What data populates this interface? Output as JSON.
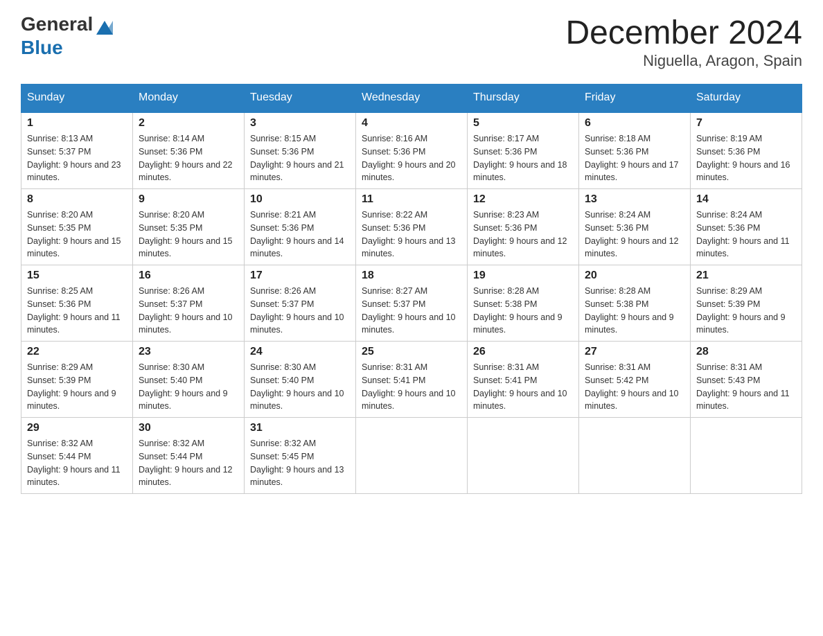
{
  "header": {
    "logo_general": "General",
    "logo_blue": "Blue",
    "title": "December 2024",
    "subtitle": "Niguella, Aragon, Spain"
  },
  "weekdays": [
    "Sunday",
    "Monday",
    "Tuesday",
    "Wednesday",
    "Thursday",
    "Friday",
    "Saturday"
  ],
  "weeks": [
    [
      {
        "day": "1",
        "sunrise": "8:13 AM",
        "sunset": "5:37 PM",
        "daylight": "9 hours and 23 minutes."
      },
      {
        "day": "2",
        "sunrise": "8:14 AM",
        "sunset": "5:36 PM",
        "daylight": "9 hours and 22 minutes."
      },
      {
        "day": "3",
        "sunrise": "8:15 AM",
        "sunset": "5:36 PM",
        "daylight": "9 hours and 21 minutes."
      },
      {
        "day": "4",
        "sunrise": "8:16 AM",
        "sunset": "5:36 PM",
        "daylight": "9 hours and 20 minutes."
      },
      {
        "day": "5",
        "sunrise": "8:17 AM",
        "sunset": "5:36 PM",
        "daylight": "9 hours and 18 minutes."
      },
      {
        "day": "6",
        "sunrise": "8:18 AM",
        "sunset": "5:36 PM",
        "daylight": "9 hours and 17 minutes."
      },
      {
        "day": "7",
        "sunrise": "8:19 AM",
        "sunset": "5:36 PM",
        "daylight": "9 hours and 16 minutes."
      }
    ],
    [
      {
        "day": "8",
        "sunrise": "8:20 AM",
        "sunset": "5:35 PM",
        "daylight": "9 hours and 15 minutes."
      },
      {
        "day": "9",
        "sunrise": "8:20 AM",
        "sunset": "5:35 PM",
        "daylight": "9 hours and 15 minutes."
      },
      {
        "day": "10",
        "sunrise": "8:21 AM",
        "sunset": "5:36 PM",
        "daylight": "9 hours and 14 minutes."
      },
      {
        "day": "11",
        "sunrise": "8:22 AM",
        "sunset": "5:36 PM",
        "daylight": "9 hours and 13 minutes."
      },
      {
        "day": "12",
        "sunrise": "8:23 AM",
        "sunset": "5:36 PM",
        "daylight": "9 hours and 12 minutes."
      },
      {
        "day": "13",
        "sunrise": "8:24 AM",
        "sunset": "5:36 PM",
        "daylight": "9 hours and 12 minutes."
      },
      {
        "day": "14",
        "sunrise": "8:24 AM",
        "sunset": "5:36 PM",
        "daylight": "9 hours and 11 minutes."
      }
    ],
    [
      {
        "day": "15",
        "sunrise": "8:25 AM",
        "sunset": "5:36 PM",
        "daylight": "9 hours and 11 minutes."
      },
      {
        "day": "16",
        "sunrise": "8:26 AM",
        "sunset": "5:37 PM",
        "daylight": "9 hours and 10 minutes."
      },
      {
        "day": "17",
        "sunrise": "8:26 AM",
        "sunset": "5:37 PM",
        "daylight": "9 hours and 10 minutes."
      },
      {
        "day": "18",
        "sunrise": "8:27 AM",
        "sunset": "5:37 PM",
        "daylight": "9 hours and 10 minutes."
      },
      {
        "day": "19",
        "sunrise": "8:28 AM",
        "sunset": "5:38 PM",
        "daylight": "9 hours and 9 minutes."
      },
      {
        "day": "20",
        "sunrise": "8:28 AM",
        "sunset": "5:38 PM",
        "daylight": "9 hours and 9 minutes."
      },
      {
        "day": "21",
        "sunrise": "8:29 AM",
        "sunset": "5:39 PM",
        "daylight": "9 hours and 9 minutes."
      }
    ],
    [
      {
        "day": "22",
        "sunrise": "8:29 AM",
        "sunset": "5:39 PM",
        "daylight": "9 hours and 9 minutes."
      },
      {
        "day": "23",
        "sunrise": "8:30 AM",
        "sunset": "5:40 PM",
        "daylight": "9 hours and 9 minutes."
      },
      {
        "day": "24",
        "sunrise": "8:30 AM",
        "sunset": "5:40 PM",
        "daylight": "9 hours and 10 minutes."
      },
      {
        "day": "25",
        "sunrise": "8:31 AM",
        "sunset": "5:41 PM",
        "daylight": "9 hours and 10 minutes."
      },
      {
        "day": "26",
        "sunrise": "8:31 AM",
        "sunset": "5:41 PM",
        "daylight": "9 hours and 10 minutes."
      },
      {
        "day": "27",
        "sunrise": "8:31 AM",
        "sunset": "5:42 PM",
        "daylight": "9 hours and 10 minutes."
      },
      {
        "day": "28",
        "sunrise": "8:31 AM",
        "sunset": "5:43 PM",
        "daylight": "9 hours and 11 minutes."
      }
    ],
    [
      {
        "day": "29",
        "sunrise": "8:32 AM",
        "sunset": "5:44 PM",
        "daylight": "9 hours and 11 minutes."
      },
      {
        "day": "30",
        "sunrise": "8:32 AM",
        "sunset": "5:44 PM",
        "daylight": "9 hours and 12 minutes."
      },
      {
        "day": "31",
        "sunrise": "8:32 AM",
        "sunset": "5:45 PM",
        "daylight": "9 hours and 13 minutes."
      },
      null,
      null,
      null,
      null
    ]
  ]
}
